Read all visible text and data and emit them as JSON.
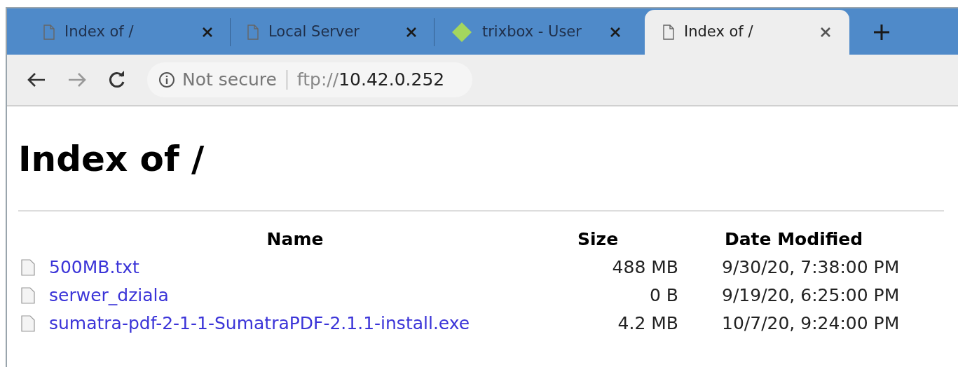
{
  "tabs": [
    {
      "title": "Index of /",
      "kind": "page",
      "selected": false
    },
    {
      "title": "Local Server",
      "kind": "page",
      "selected": false
    },
    {
      "title": "trixbox - User",
      "kind": "site",
      "selected": false
    },
    {
      "title": "Index of /",
      "kind": "page",
      "selected": true
    }
  ],
  "address_bar": {
    "security": "Not secure",
    "scheme": "ftp://",
    "host": "10.42.0.252"
  },
  "page": {
    "heading": "Index of /",
    "table": {
      "columns": [
        "Name",
        "Size",
        "Date Modified"
      ],
      "rows": [
        {
          "name": "500MB.txt",
          "size": "488 MB",
          "date": "9/30/20, 7:38:00 PM"
        },
        {
          "name": "serwer_dziala",
          "size": "0 B",
          "date": "9/19/20, 6:25:00 PM"
        },
        {
          "name": "sumatra-pdf-2-1-1-SumatraPDF-2.1.1-install.exe",
          "size": "4.2 MB",
          "date": "10/7/20, 9:24:00 PM"
        }
      ]
    }
  }
}
